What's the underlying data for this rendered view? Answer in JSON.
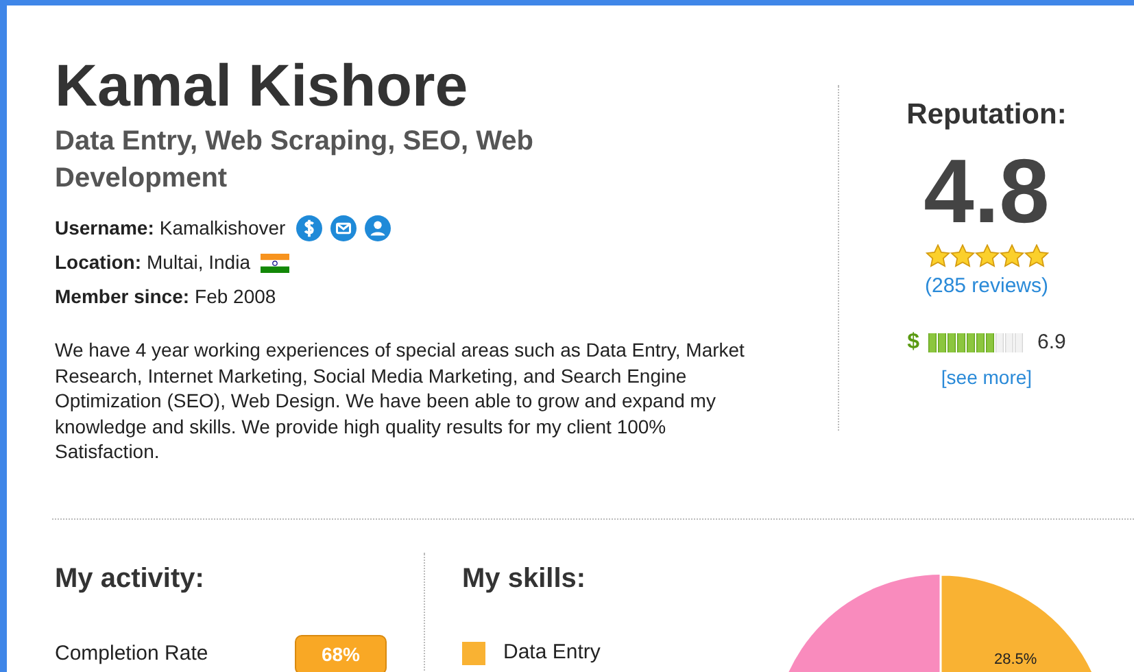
{
  "profile": {
    "name": "Kamal Kishore",
    "headline": "Data Entry, Web Scraping, SEO, Web Development",
    "fields": [
      {
        "label": "Username:",
        "value": "Kamalkishover",
        "kind": "username"
      },
      {
        "label": "Location:",
        "value": "Multai, India",
        "kind": "location"
      },
      {
        "label": "Member since:",
        "value": "Feb 2008",
        "kind": "plain"
      }
    ],
    "description": "We have 4 year working experiences of special areas such as Data Entry, Market Research, Internet Marketing, Social Media Marketing, and Search Engine Optimization (SEO), Web Design. We have been able to grow and expand my knowledge and skills. We provide high quality results for my client 100% Satisfaction."
  },
  "reputation": {
    "title": "Reputation:",
    "score": "4.8",
    "stars": 5,
    "reviews": "(285 reviews)",
    "currency": "$",
    "level": 0.7,
    "reading": "6.9",
    "see_more": "[see more]"
  },
  "activity": {
    "title": "My activity:",
    "items": [
      {
        "label": "Completion Rate",
        "value": "68%"
      }
    ]
  },
  "skills": {
    "title": "My skills:",
    "legend": [
      {
        "label": "Data Entry",
        "color": "#f9b233"
      }
    ],
    "slice_label": "28.5%"
  }
}
